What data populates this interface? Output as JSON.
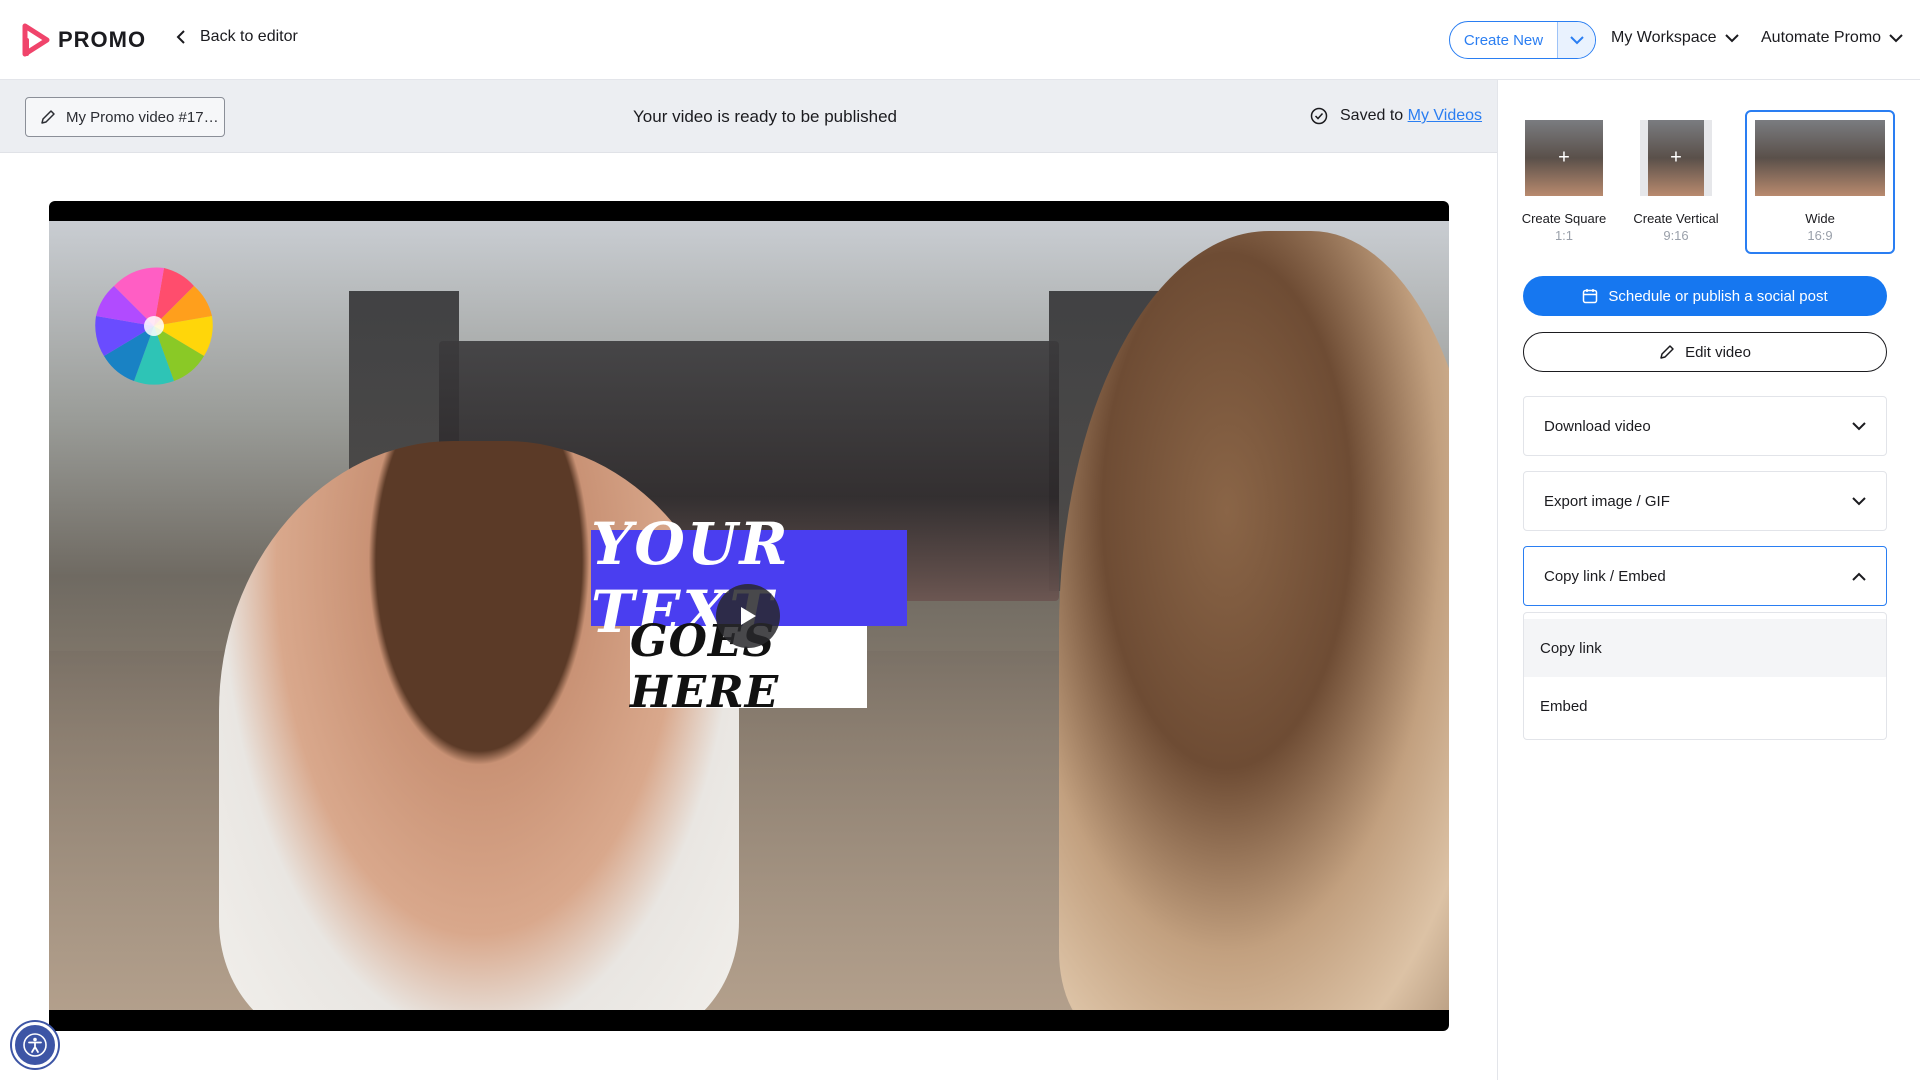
{
  "brand": {
    "name": "PROMO",
    "accent": "#2a7ef2",
    "logo_color": "#f0446b"
  },
  "header": {
    "back_label": "Back to editor",
    "create_new_label": "Create New",
    "workspace_label": "My Workspace",
    "automate_label": "Automate Promo"
  },
  "main": {
    "video_name": "My Promo video #17…",
    "status_text": "Your video is ready to be published",
    "saved_prefix": "Saved to",
    "saved_link": "My Videos"
  },
  "video": {
    "overlay_line1": "YOUR TEXT",
    "overlay_line2": "GOES HERE",
    "banner_color": "#4a3ef0"
  },
  "panel": {
    "formats": [
      {
        "label": "Create Square",
        "ratio": "1:1",
        "icon": "plus-icon"
      },
      {
        "label": "Create Vertical",
        "ratio": "9:16",
        "icon": "plus-icon"
      },
      {
        "label": "Wide",
        "ratio": "16:9",
        "selected": true
      }
    ],
    "schedule_label": "Schedule or publish a social post",
    "edit_label": "Edit video",
    "accordions": [
      {
        "label": "Download video",
        "open": false
      },
      {
        "label": "Export image / GIF",
        "open": false
      },
      {
        "label": "Copy link / Embed",
        "open": true
      }
    ],
    "menu_items": [
      "Copy link",
      "Embed"
    ]
  }
}
